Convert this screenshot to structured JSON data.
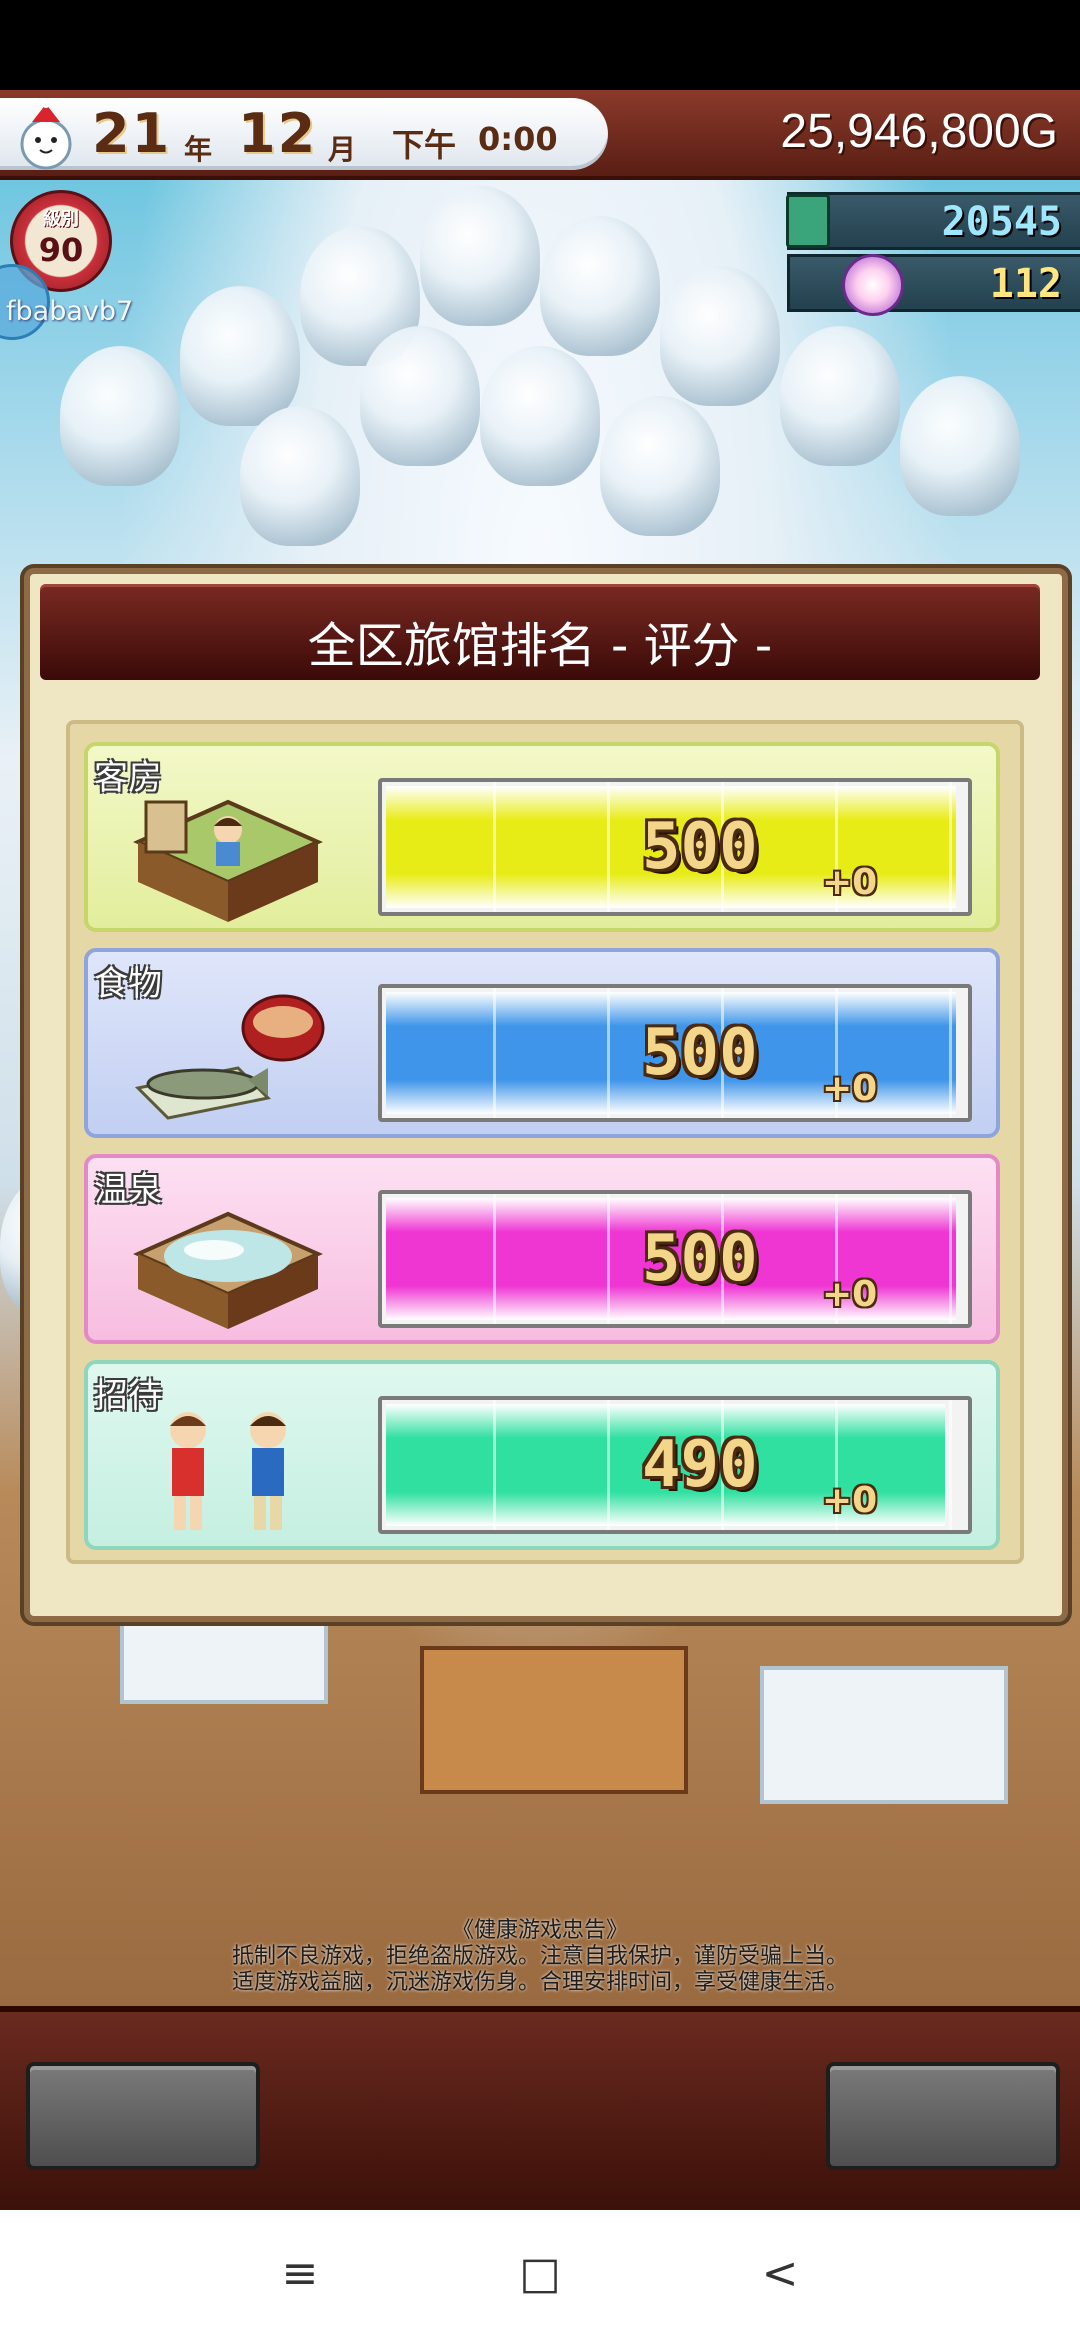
{
  "hud": {
    "year": "21",
    "year_unit": "年",
    "month": "12",
    "month_unit": "月",
    "ampm": "下午",
    "time": "0:00",
    "gold": "25,946,800G"
  },
  "player": {
    "level_label": "級別",
    "level": "90",
    "id": "fbabavb7"
  },
  "resources": {
    "tickets": "20545",
    "onsen_points": "112"
  },
  "dialog": {
    "title": "全区旅馆排名 - 评分 -",
    "rows": [
      {
        "label": "客房",
        "value": "500",
        "delta": "+0",
        "fill": 1.0,
        "color": "#e8ec16",
        "icon": "guest-room-icon"
      },
      {
        "label": "食物",
        "value": "500",
        "delta": "+0",
        "fill": 1.0,
        "color": "#3f95ea",
        "icon": "fish-meal-icon"
      },
      {
        "label": "温泉",
        "value": "500",
        "delta": "+0",
        "fill": 1.0,
        "color": "#ef35d2",
        "icon": "hot-spring-icon"
      },
      {
        "label": "招待",
        "value": "490",
        "delta": "+0",
        "fill": 0.98,
        "color": "#2fe0a0",
        "icon": "staff-icon"
      }
    ]
  },
  "notice": {
    "title": "《健康游戏忠告》",
    "line1": "抵制不良游戏，拒绝盗版游戏。注意自我保护，谨防受骗上当。",
    "line2": "适度游戏益脑，沉迷游戏伤身。合理安排时间，享受健康生活。"
  },
  "nav": {
    "menu": "≡",
    "home": "□",
    "back": "<"
  }
}
